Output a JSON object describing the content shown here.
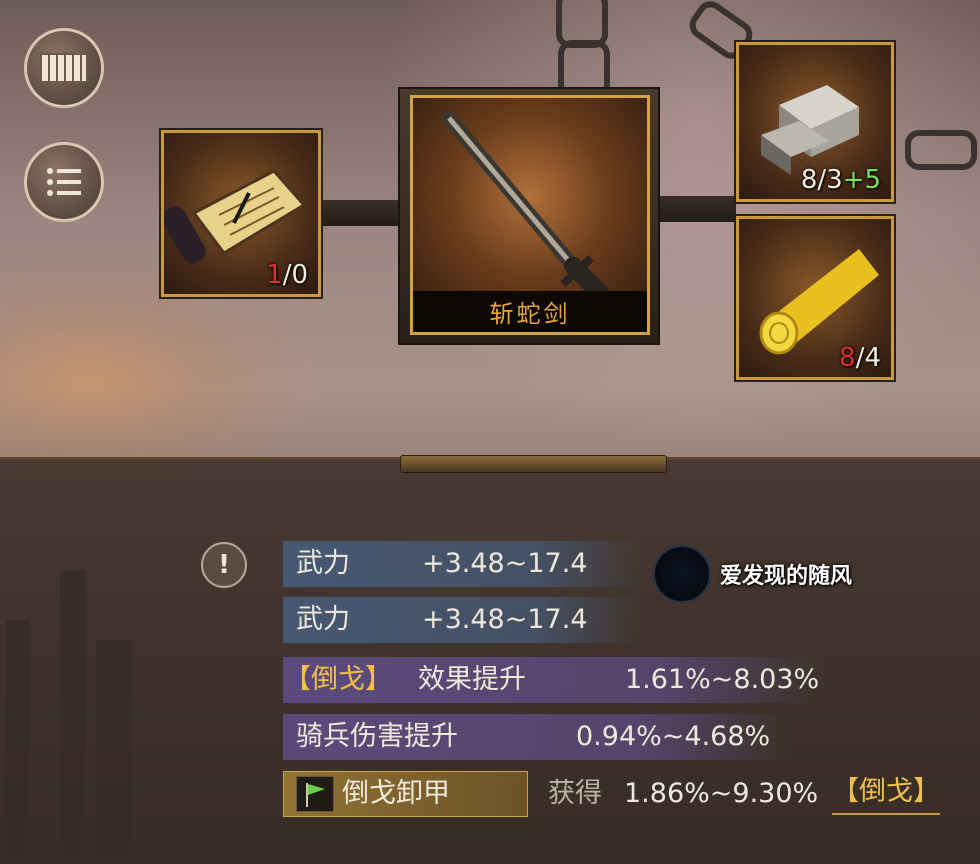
{
  "weapon": {
    "name": "斩蛇剑"
  },
  "materials": [
    {
      "name_icon": "scroll-manual-icon",
      "count_current": "1",
      "count_separator": "/",
      "count_required": "0"
    },
    {
      "name_icon": "silver-ingot-icon",
      "count_current": "8",
      "count_separator": "/",
      "count_required": "3",
      "count_bonus": "+5"
    },
    {
      "name_icon": "gold-wood-log-icon",
      "count_current": "8",
      "count_separator": "/",
      "count_required": "4"
    }
  ],
  "stats": [
    {
      "label": "武力",
      "value": "+3.48~17.4"
    },
    {
      "label": "武力",
      "value": "+3.48~17.4"
    },
    {
      "label_bracket": "【倒戈】",
      "label": "效果提升",
      "value": "1.61%~8.03%"
    },
    {
      "label": "骑兵伤害提升",
      "value": "0.94%~4.68%"
    }
  ],
  "special": {
    "name": "倒戈卸甲",
    "prefix": "获得",
    "value": "1.86%~9.30%",
    "link": "【倒戈】"
  },
  "watermark": {
    "author": "爱发现的随风"
  },
  "colors": {
    "gold_border": "#c89a3a",
    "weapon_name": "#e8a63a",
    "count_red": "#d8302a",
    "count_green": "#7ce05a",
    "stat_blue": "#465a76",
    "stat_purple": "#5c4c80",
    "stat_gold": "#967634"
  }
}
